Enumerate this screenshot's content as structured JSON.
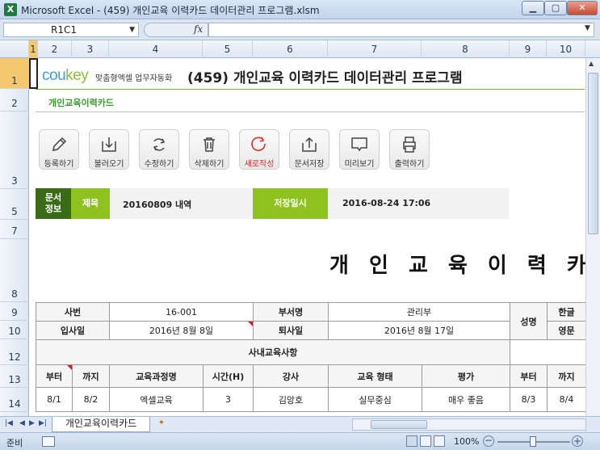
{
  "window": {
    "title": "Microsoft Excel - (459) 개인교육 이력카드 데이터관리 프로그램.xlsm",
    "app_icon": "X"
  },
  "formula_bar": {
    "name_box": "R1C1",
    "formula": ""
  },
  "columns": [
    "1",
    "2",
    "3",
    "4",
    "5",
    "6",
    "7",
    "8",
    "9",
    "10"
  ],
  "rows": [
    "1",
    "2",
    "3",
    "5",
    "7",
    "8",
    "9",
    "10",
    "12",
    "13",
    "14"
  ],
  "logo": {
    "brand_a": "cou",
    "brand_b": "key",
    "tagline": "맞춤형엑셀 업무자동화"
  },
  "header": {
    "title": "(459) 개인교육 이력카드 데이터관리 프로그램",
    "subtitle": "개인교육이력카드"
  },
  "toolbar": [
    {
      "label": "등록하기",
      "icon": "pencil-icon"
    },
    {
      "label": "불러오기",
      "icon": "load-icon"
    },
    {
      "label": "수정하기",
      "icon": "refresh-icon"
    },
    {
      "label": "삭제하기",
      "icon": "trash-icon"
    },
    {
      "label": "새로작성",
      "icon": "new-icon"
    },
    {
      "label": "문서저장",
      "icon": "save-icon"
    },
    {
      "label": "미리보기",
      "icon": "monitor-icon"
    },
    {
      "label": "출력하기",
      "icon": "printer-icon"
    }
  ],
  "docinfo": {
    "section_label": "문서\n정보",
    "subject_label": "제목",
    "subject_value": "20160809 내역",
    "saved_label": "저장일시",
    "saved_value": "2016-08-24 17:06"
  },
  "card_title": "개 인 교 육 이 력 카 드",
  "card": {
    "emp_no_label": "사번",
    "emp_no": "16-001",
    "dept_label": "부서명",
    "dept": "관리부",
    "name_label": "성명",
    "name_kr_label": "한글",
    "name_en_label": "영문",
    "join_label": "입사일",
    "join_date": "2016년 8월 8일",
    "leave_label": "퇴사일",
    "leave_date": "2016년 8월 17일",
    "section_label": "사내교육사항",
    "cols": [
      "부터",
      "까지",
      "교육과정명",
      "시간(H)",
      "강사",
      "교육 형태",
      "평가",
      "부터",
      "까지"
    ],
    "rows": [
      [
        "8/1",
        "8/2",
        "엑셀교육",
        "3",
        "김앙호",
        "실무중심",
        "매우 좋음",
        "8/3",
        "8/4"
      ]
    ]
  },
  "sheet_tab": "개인교육이력카드",
  "status": {
    "ready": "준비",
    "zoom": "100%"
  }
}
